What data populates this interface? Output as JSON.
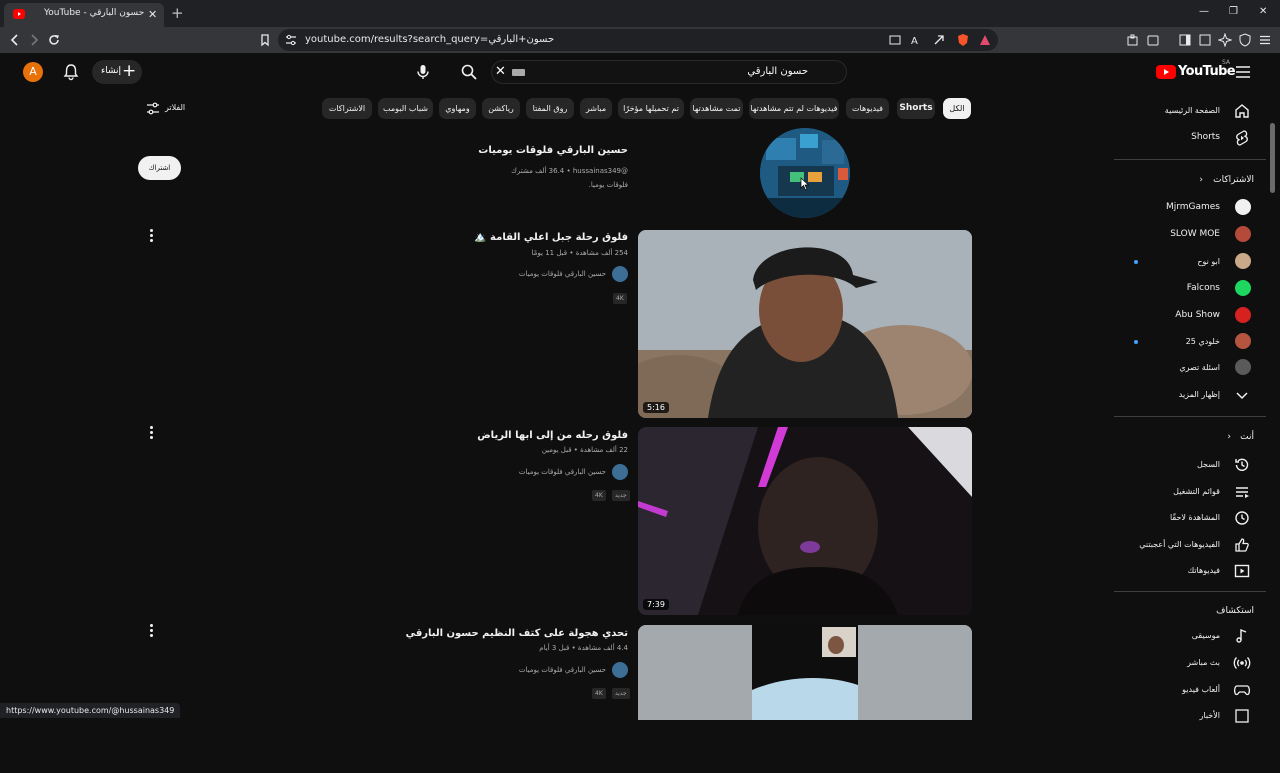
{
  "browser": {
    "tab_title": "YouTube - حسون البارقي",
    "url": "youtube.com/results?search_query=حسون+البارقي",
    "status_url": "https://www.youtube.com/@hussainas349"
  },
  "header": {
    "avatar_letter": "A",
    "create_label": "إنشاء",
    "search_query": "حسون البارقي",
    "logo_text": "YouTube",
    "country": "SA"
  },
  "chips": [
    "الكل",
    "Shorts",
    "فيديوهات",
    "فيديوهات لم تتم مشاهدتها",
    "تمت مشاهدتها",
    "تم تحميلها مؤخرًا",
    "مباشر",
    "روق المفتا",
    "رياكشن",
    "ومهاوي",
    "شباب البومب",
    "الاشتراكات"
  ],
  "filters_label": "الفلاتر",
  "channel": {
    "name": "حسين البارقي فلوقات يوميات",
    "meta": "@hussainas349 • ‏36.4 ألف مشترك",
    "desc": "فلوقات يوميا.",
    "subscribe_label": "اشتراك"
  },
  "videos": [
    {
      "title": "فلوق رحلة جبل اعلي القامة 🏔️",
      "meta": "254 ألف مشاهدة • قبل 11 يومًا",
      "channel": "حسين البارقي فلوقات يوميات",
      "badges": [
        "4K"
      ],
      "duration": "5:16"
    },
    {
      "title": "فلوق رحله من إلى ابها الرياض",
      "meta": "22 ألف مشاهدة • قبل يومين",
      "channel": "حسين البارقي فلوقات يوميات",
      "badges": [
        "جديد",
        "4K"
      ],
      "duration": "7:39"
    },
    {
      "title": "تحدي هجولة على كتف النظيم حسون البارقي",
      "meta": "4.4 ألف مشاهدة • قبل 3 أيام",
      "channel": "حسين البارقي فلوقات يوميات",
      "badges": [
        "جديد",
        "4K"
      ],
      "duration": ""
    }
  ],
  "sidebar": {
    "top": [
      {
        "label": "الصفحة الرئيسية",
        "icon": "home-icon"
      },
      {
        "label": "Shorts",
        "icon": "shorts-icon"
      }
    ],
    "subs_header": "الاشتراكات",
    "subscriptions": [
      {
        "label": "MjrmGames",
        "color": "#ffffff",
        "dot": false
      },
      {
        "label": "SLOW MOE",
        "color": "#b34a3a",
        "dot": false
      },
      {
        "label": "ابو نوح",
        "color": "#caa98a",
        "dot": true
      },
      {
        "label": "Falcons",
        "color": "#1ed760",
        "dot": false
      },
      {
        "label": "Abu Show",
        "color": "#d62121",
        "dot": false
      },
      {
        "label": "خلودي 25",
        "color": "#b5553f",
        "dot": true
      },
      {
        "label": "اسئلة تصري",
        "color": "#5a5a5a",
        "dot": false
      }
    ],
    "show_more": "إظهار المزيد",
    "you_header": "أنت",
    "you": [
      {
        "label": "السجل",
        "icon": "history-icon"
      },
      {
        "label": "قوائم التشغيل",
        "icon": "playlists-icon"
      },
      {
        "label": "المشاهدة لاحقًا",
        "icon": "watch-later-icon"
      },
      {
        "label": "الفيديوهات التي أعجبتني",
        "icon": "like-icon"
      },
      {
        "label": "فيديوهاتك",
        "icon": "your-videos-icon"
      }
    ],
    "explore_header": "استكشاف",
    "explore": [
      {
        "label": "موسيقى",
        "icon": "music-icon"
      },
      {
        "label": "بث مباشر",
        "icon": "live-icon"
      },
      {
        "label": "ألعاب فيديو",
        "icon": "gaming-icon"
      },
      {
        "label": "الأخبار",
        "icon": "news-icon"
      }
    ]
  }
}
